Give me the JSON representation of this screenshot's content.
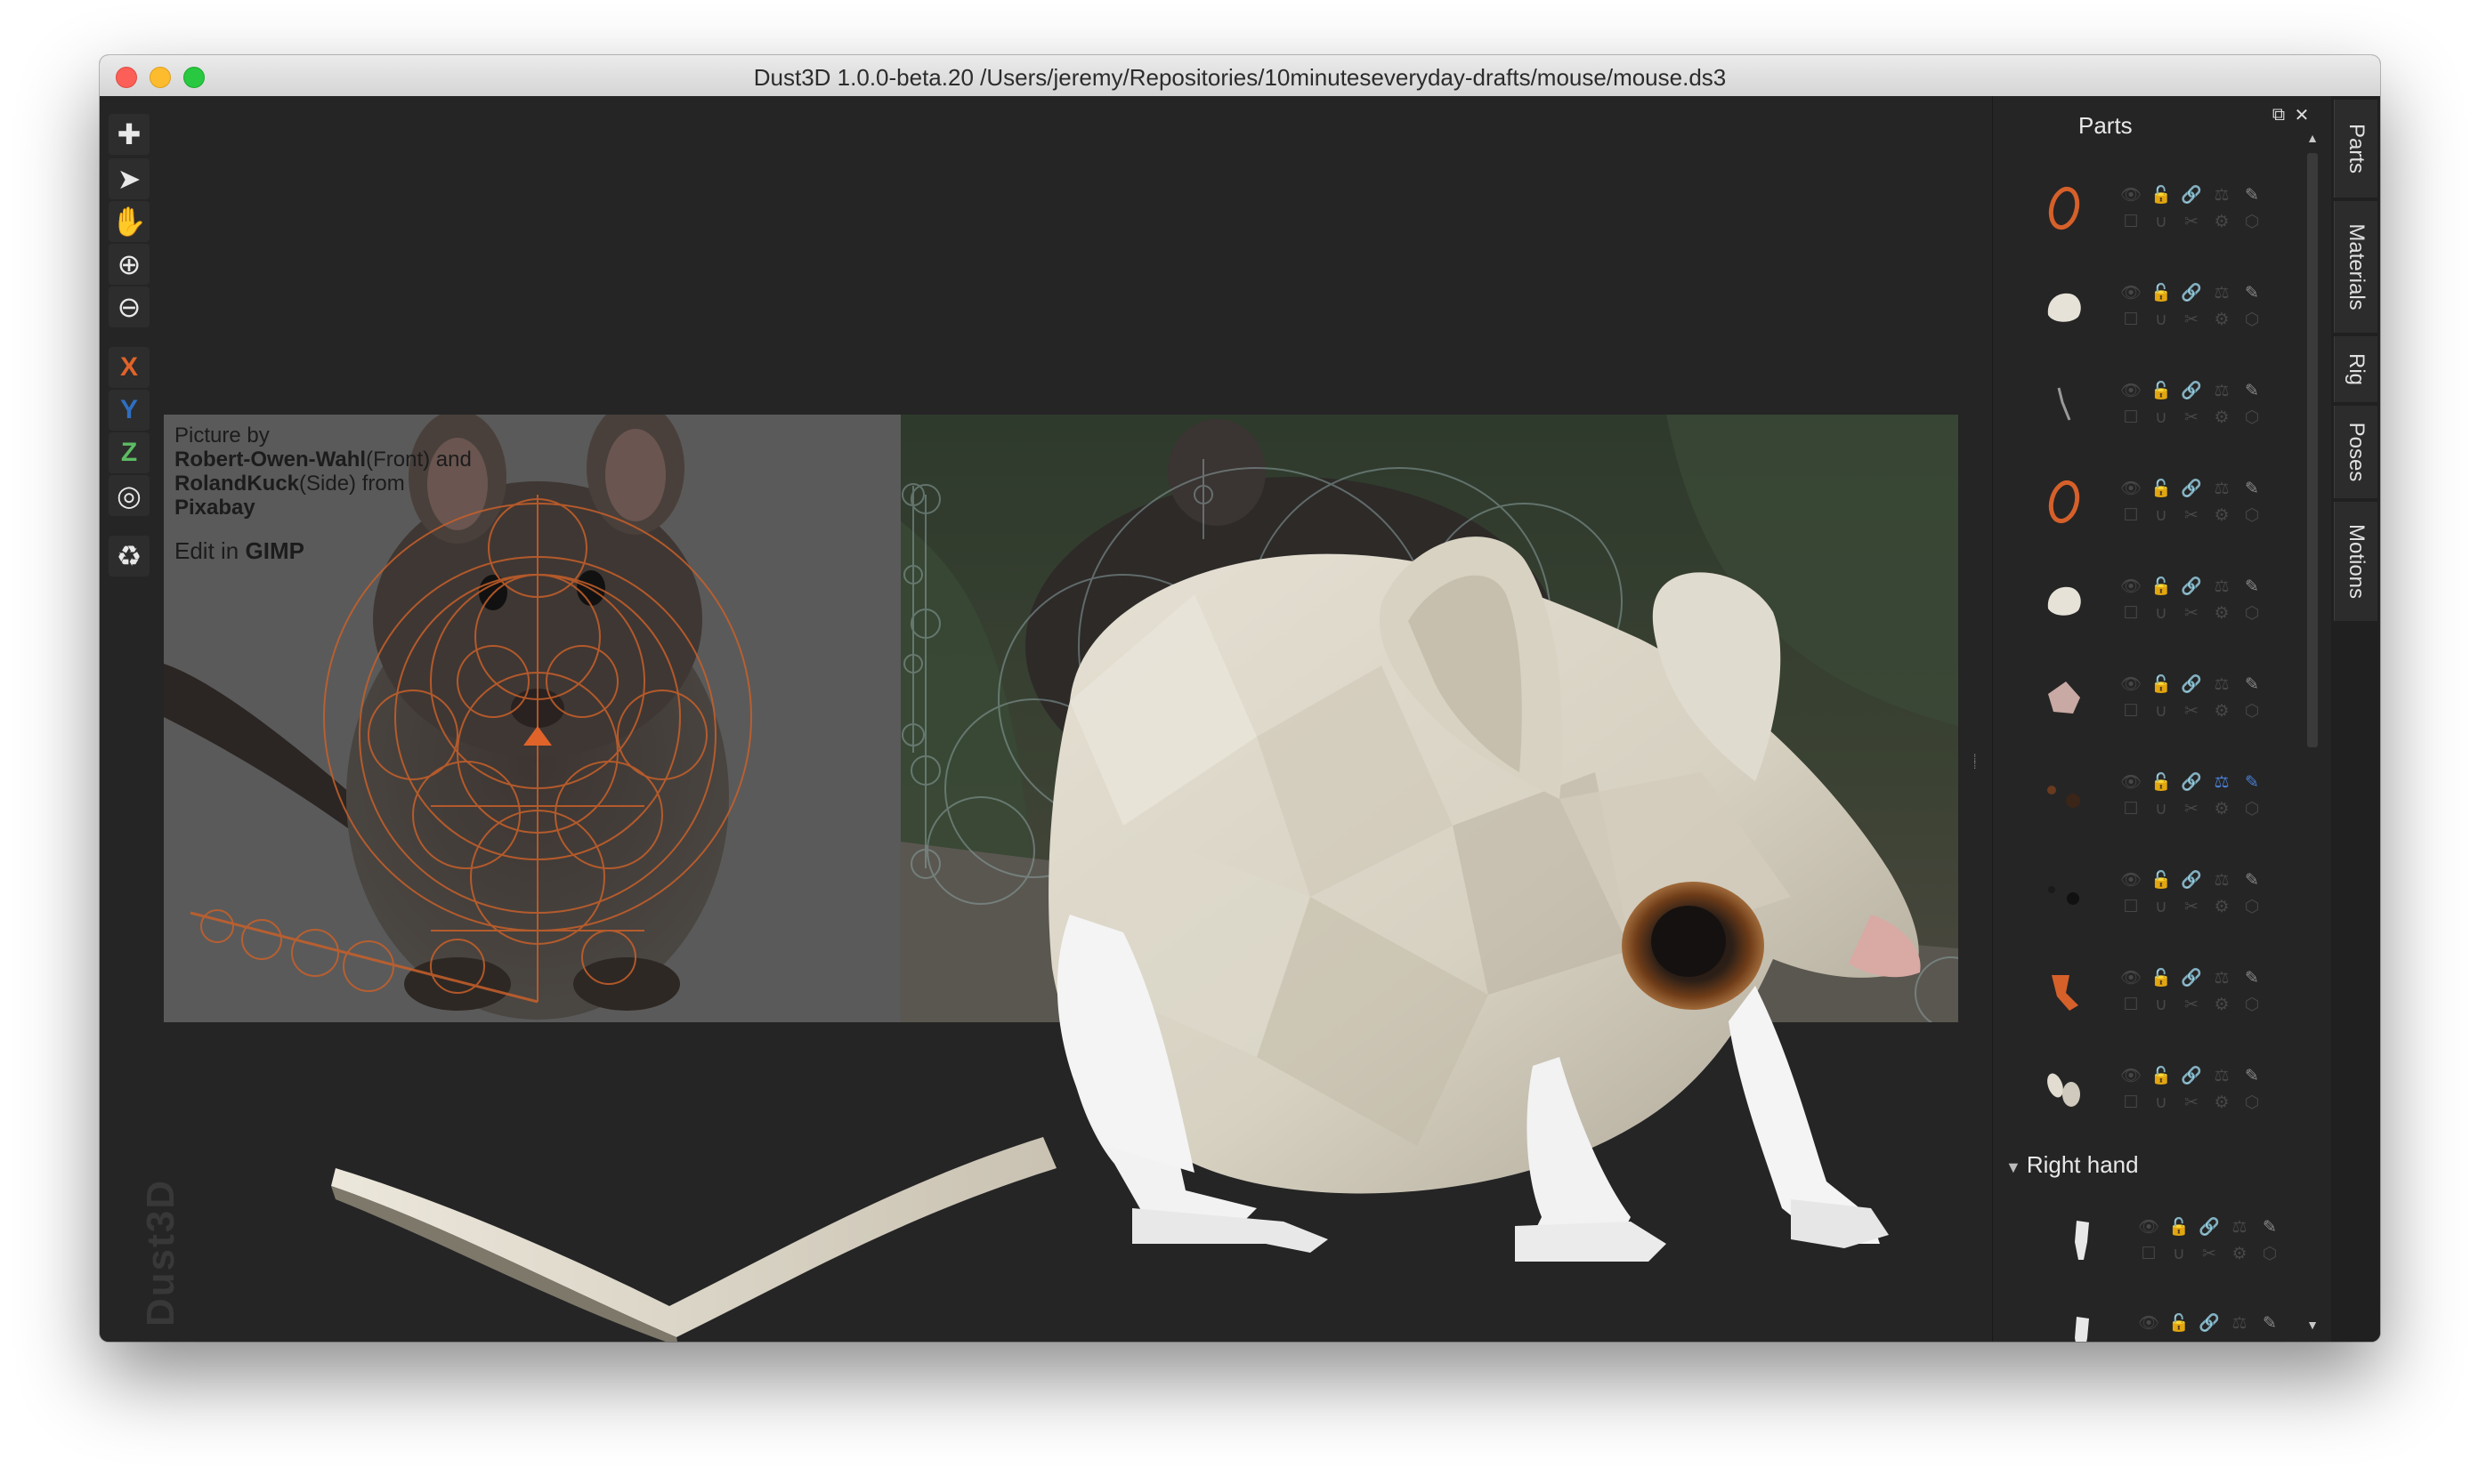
{
  "window": {
    "title": "Dust3D 1.0.0-beta.20 /Users/jeremy/Repositories/10minuteseveryday-drafts/mouse/mouse.ds3"
  },
  "toolbar": {
    "tools": [
      {
        "name": "add-tool",
        "glyph": "✚"
      },
      {
        "name": "select-tool",
        "glyph": "➤"
      },
      {
        "name": "pan-tool",
        "glyph": "✋"
      },
      {
        "name": "zoom-in-tool",
        "glyph": "⊕"
      },
      {
        "name": "zoom-out-tool",
        "glyph": "⊖"
      }
    ],
    "axes": [
      {
        "label": "X",
        "color": "#e0632a"
      },
      {
        "label": "Y",
        "color": "#2e6fc0"
      },
      {
        "label": "Z",
        "color": "#5dbb63"
      }
    ],
    "radius_glyph": "◎",
    "regenerate_glyph": "♻"
  },
  "reference": {
    "credit_line1": "Picture by",
    "author1": "Robert-Owen-Wahl",
    "author1_role": "(Front) and",
    "author2": "RolandKuck",
    "author2_role": "(Side) from",
    "source": "Pixabay",
    "edit_prefix": "Edit in ",
    "edit_app": "GIMP"
  },
  "watermark": "Dust3D",
  "parts_panel": {
    "title": "Parts",
    "float_glyph": "⧉",
    "close_glyph": "✕",
    "group_label": "Right hand",
    "group_arrow": "▼",
    "button_glyphs": [
      "👁",
      "🔓",
      "🔗",
      "⚖",
      "✎",
      "☐",
      "∪",
      "✂",
      "⚙",
      "⬡"
    ],
    "parts": [
      {
        "thumb": "ring-orange"
      },
      {
        "thumb": "blob-white"
      },
      {
        "thumb": "whisker-grey"
      },
      {
        "thumb": "ring-orange"
      },
      {
        "thumb": "blob-white"
      },
      {
        "thumb": "blob-pink"
      },
      {
        "thumb": "dots-brown"
      },
      {
        "thumb": "dots-black"
      },
      {
        "thumb": "leg-orange"
      },
      {
        "thumb": "ears-white"
      }
    ],
    "group_parts": [
      {
        "thumb": "finger-white"
      },
      {
        "thumb": "finger-white"
      }
    ]
  },
  "side_tabs": [
    "Parts",
    "Materials",
    "Rig",
    "Poses",
    "Motions"
  ],
  "colors": {
    "background": "#252525",
    "accent_orange": "#e0632a",
    "mouse_body": "#d9d3c4"
  }
}
